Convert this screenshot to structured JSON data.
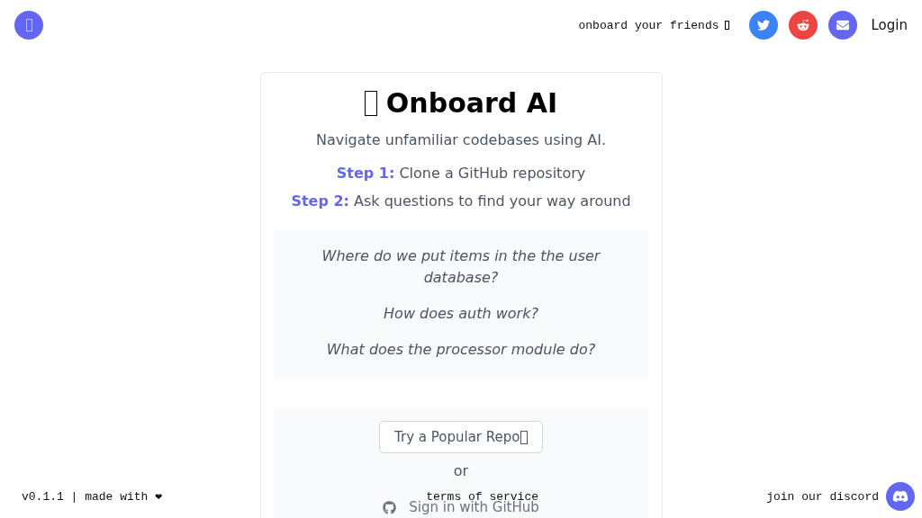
{
  "header": {
    "share_label": "onboard your friends",
    "login": "Login"
  },
  "card": {
    "title": "Onboard AI",
    "subtitle": "Navigate unfamiliar codebases using AI.",
    "steps": [
      {
        "label": "Step 1:",
        "text": "Clone a GitHub repository"
      },
      {
        "label": "Step 2:",
        "text": "Ask questions to find your way around"
      }
    ],
    "examples": [
      "Where do we put items in the the user database?",
      "How does auth work?",
      "What does the processor module do?"
    ],
    "try_button": "Try a Popular Repo",
    "or": "or",
    "github_button": "Sign in with GitHub"
  },
  "footer": {
    "version": "v0.1.1 | made with ❤",
    "terms": "terms of service",
    "discord": "join our discord"
  }
}
